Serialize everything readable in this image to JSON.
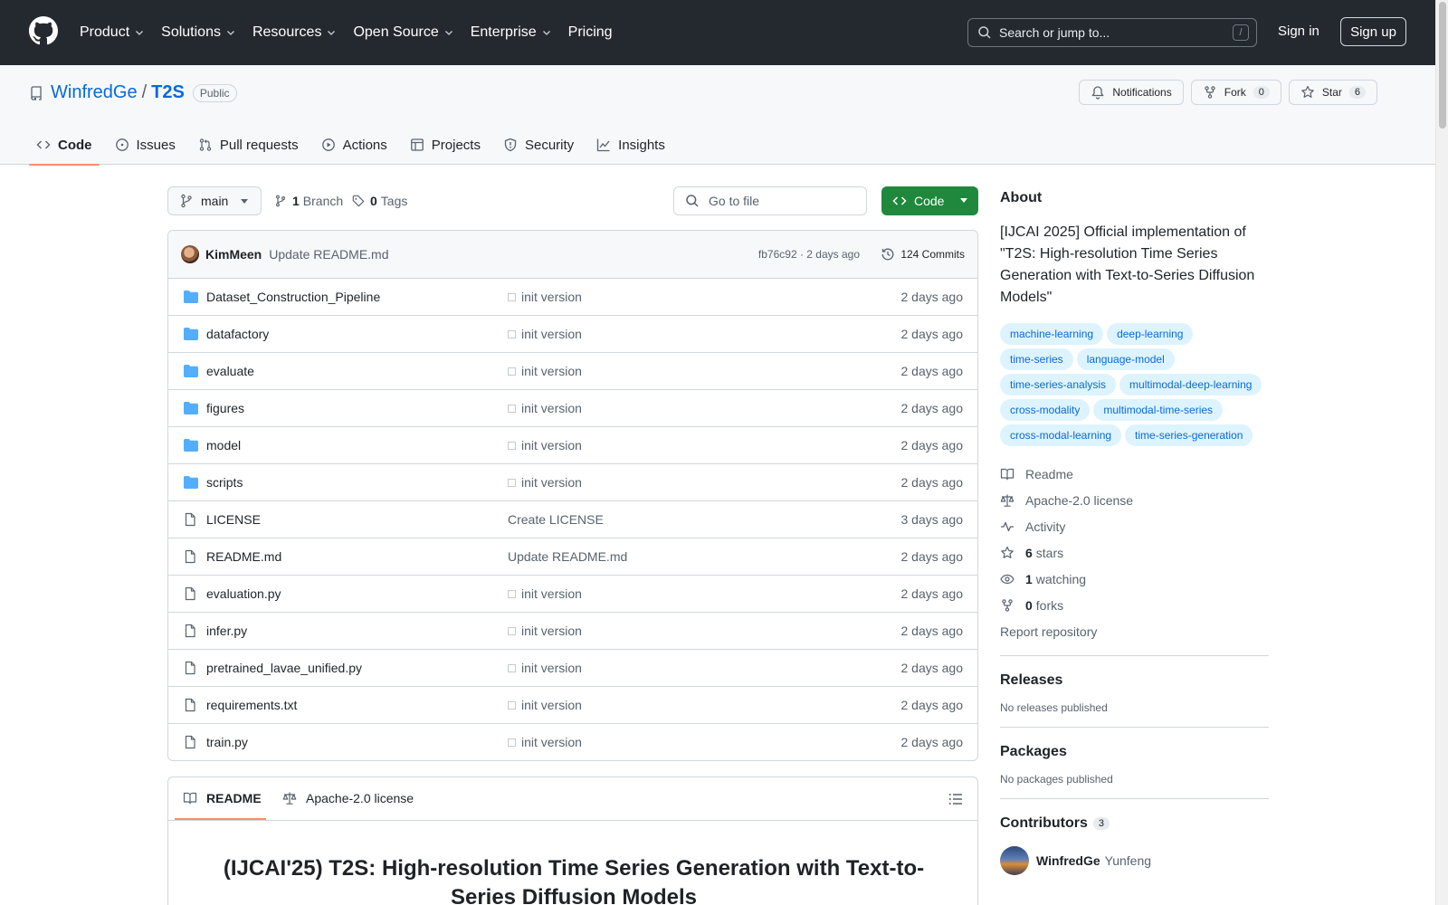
{
  "header": {
    "nav": [
      {
        "label": "Product",
        "has_menu": true
      },
      {
        "label": "Solutions",
        "has_menu": true
      },
      {
        "label": "Resources",
        "has_menu": true
      },
      {
        "label": "Open Source",
        "has_menu": true
      },
      {
        "label": "Enterprise",
        "has_menu": true
      },
      {
        "label": "Pricing",
        "has_menu": false
      }
    ],
    "search_placeholder": "Search or jump to...",
    "search_shortcut": "/",
    "sign_in": "Sign in",
    "sign_up": "Sign up"
  },
  "repo": {
    "owner": "WinfredGe",
    "separator": "/",
    "name": "T2S",
    "visibility": "Public",
    "actions": {
      "notifications": "Notifications",
      "fork": "Fork",
      "fork_count": "0",
      "star": "Star",
      "star_count": "6"
    },
    "tabs": [
      {
        "label": "Code",
        "icon": "code-icon",
        "active": true
      },
      {
        "label": "Issues",
        "icon": "issue-icon",
        "active": false
      },
      {
        "label": "Pull requests",
        "icon": "pull-request-icon",
        "active": false
      },
      {
        "label": "Actions",
        "icon": "play-icon",
        "active": false
      },
      {
        "label": "Projects",
        "icon": "table-icon",
        "active": false
      },
      {
        "label": "Security",
        "icon": "shield-icon",
        "active": false
      },
      {
        "label": "Insights",
        "icon": "graph-icon",
        "active": false
      }
    ]
  },
  "toolbar": {
    "branch": "main",
    "branch_count": "1",
    "branch_label": "Branch",
    "tag_count": "0",
    "tag_label": "Tags",
    "go_to_file": "Go to file",
    "code_button": "Code"
  },
  "latest_commit": {
    "author": "KimMeen",
    "message": "Update README.md",
    "meta": "fb76c92 · 2 days ago",
    "commits_label": "124 Commits"
  },
  "files": [
    {
      "name": "Dataset_Construction_Pipeline",
      "type": "dir",
      "message": "init version",
      "date": "2 days ago"
    },
    {
      "name": "datafactory",
      "type": "dir",
      "message": "init version",
      "date": "2 days ago"
    },
    {
      "name": "evaluate",
      "type": "dir",
      "message": "init version",
      "date": "2 days ago"
    },
    {
      "name": "figures",
      "type": "dir",
      "message": "init version",
      "date": "2 days ago"
    },
    {
      "name": "model",
      "type": "dir",
      "message": "init version",
      "date": "2 days ago"
    },
    {
      "name": "scripts",
      "type": "dir",
      "message": "init version",
      "date": "2 days ago"
    },
    {
      "name": "LICENSE",
      "type": "file",
      "message": "Create LICENSE",
      "date": "3 days ago"
    },
    {
      "name": "README.md",
      "type": "file",
      "message": "Update README.md",
      "date": "2 days ago"
    },
    {
      "name": "evaluation.py",
      "type": "file",
      "message": "init version",
      "date": "2 days ago"
    },
    {
      "name": "infer.py",
      "type": "file",
      "message": "init version",
      "date": "2 days ago"
    },
    {
      "name": "pretrained_lavae_unified.py",
      "type": "file",
      "message": "init version",
      "date": "2 days ago"
    },
    {
      "name": "requirements.txt",
      "type": "file",
      "message": "init version",
      "date": "2 days ago"
    },
    {
      "name": "train.py",
      "type": "file",
      "message": "init version",
      "date": "2 days ago"
    }
  ],
  "readme": {
    "tab_readme": "README",
    "tab_license": "Apache-2.0 license",
    "title": "(IJCAI'25) T2S: High-resolution Time Series Generation with Text-to-Series Diffusion Models"
  },
  "about": {
    "heading": "About",
    "description": "[IJCAI 2025] Official implementation of \"T2S: High-resolution Time Series Generation with Text-to-Series Diffusion Models\"",
    "topics": [
      "machine-learning",
      "deep-learning",
      "time-series",
      "language-model",
      "time-series-analysis",
      "multimodal-deep-learning",
      "cross-modality",
      "multimodal-time-series",
      "cross-modal-learning",
      "time-series-generation"
    ],
    "readme": "Readme",
    "license": "Apache-2.0 license",
    "activity": "Activity",
    "stars_count": "6",
    "stars_label": "stars",
    "watching_count": "1",
    "watching_label": "watching",
    "forks_count": "0",
    "forks_label": "forks",
    "report": "Report repository"
  },
  "releases": {
    "heading": "Releases",
    "empty": "No releases published"
  },
  "packages": {
    "heading": "Packages",
    "empty": "No packages published"
  },
  "contributors": {
    "heading": "Contributors",
    "count": "3",
    "first_login": "WinfredGe",
    "first_name": "Yunfeng"
  },
  "colors": {
    "header_bg": "#24292f",
    "link": "#0969da",
    "green": "#1f883d",
    "tab_underline": "#fd8c73",
    "folder": "#54aeff"
  }
}
